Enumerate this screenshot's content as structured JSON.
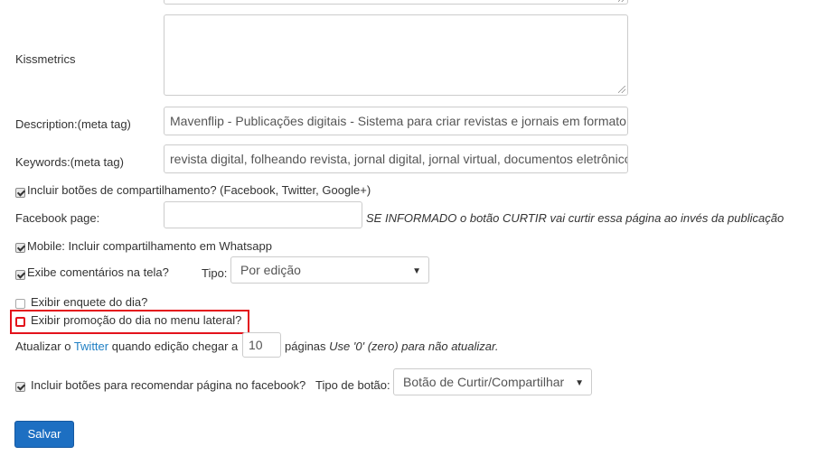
{
  "kissmetrics_label": "Kissmetrics",
  "description": {
    "label": "Description:(meta tag)",
    "value": "Mavenflip - Publicações digitais - Sistema para criar revistas e jornais em formato"
  },
  "keywords": {
    "label": "Keywords:(meta tag)",
    "value": "revista digital, folheando revista, jornal digital, jornal virtual, documentos eletrônicos"
  },
  "share_buttons": {
    "label": "Incluir botões de compartilhamento? (Facebook, Twitter, Google+)",
    "checked": true
  },
  "facebook_page": {
    "label": "Facebook page:",
    "value": "",
    "hint": "SE INFORMADO o botão CURTIR vai curtir essa página ao invés da publicação"
  },
  "whatsapp": {
    "label": "Mobile: Incluir compartilhamento em Whatsapp",
    "checked": true
  },
  "comments": {
    "label": "Exibe comentários na tela?",
    "checked": true,
    "type_label": "Tipo:",
    "type_value": "Por edição"
  },
  "poll": {
    "label": "Exibir enquete do dia?",
    "checked": false
  },
  "promo": {
    "label": "Exibir promoção do dia no menu lateral?",
    "checked": false
  },
  "twitter_update": {
    "prefix": "Atualizar o",
    "link": "Twitter",
    "middle": "quando edição chegar a",
    "value": "10",
    "suffix": "páginas",
    "hint": "Use '0' (zero) para não atualizar."
  },
  "recommend": {
    "label": "Incluir botões para recomendar página no facebook?",
    "checked": true,
    "type_label": "Tipo de botão:",
    "type_value": "Botão de Curtir/Compartilhar"
  },
  "save_label": "Salvar",
  "icons": {
    "caret": "chevron-down-icon",
    "resize": "resize-grip-icon"
  },
  "colors": {
    "save_button": "#1d6fc2",
    "link": "#1f7fc4",
    "highlight": "#e3121b"
  }
}
